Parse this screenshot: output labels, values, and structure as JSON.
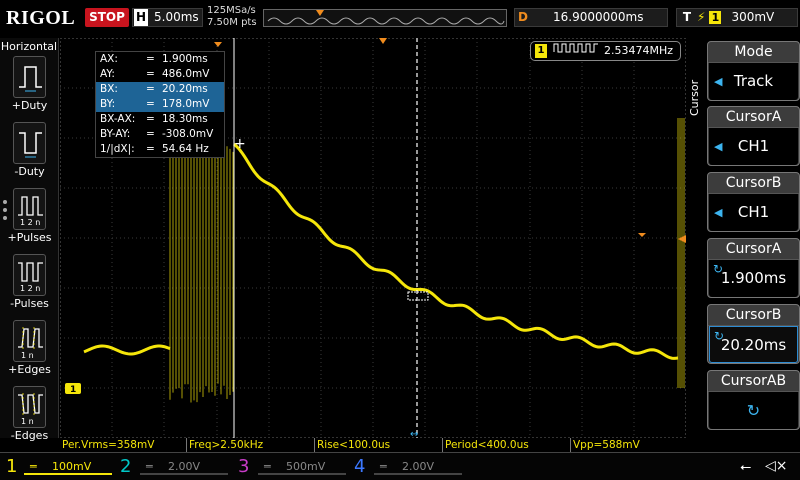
{
  "top": {
    "brand": "RIGOL",
    "run_state": "STOP",
    "horizontal_label": "H",
    "horizontal_scale": "5.00ms",
    "sample_rate": "125MSa/s",
    "memory_depth": "7.50M pts",
    "delay_label": "D",
    "delay_value": "16.9000000ms",
    "trigger_label": "T",
    "trigger_channel": "1",
    "trigger_level": "300mV"
  },
  "left_panel": {
    "title": "Horizontal",
    "items": [
      {
        "label": "+Duty"
      },
      {
        "label": "-Duty"
      },
      {
        "label": "+Pulses"
      },
      {
        "label": "-Pulses"
      },
      {
        "label": "+Edges"
      },
      {
        "label": "-Edges"
      }
    ]
  },
  "cursor_readout": {
    "rows": [
      {
        "key": "AX:",
        "value": "1.900ms",
        "highlight": false
      },
      {
        "key": "AY:",
        "value": "486.0mV",
        "highlight": false
      },
      {
        "key": "BX:",
        "value": "20.20ms",
        "highlight": true
      },
      {
        "key": "BY:",
        "value": "178.0mV",
        "highlight": true
      },
      {
        "key": "BX-AX:",
        "value": "18.30ms",
        "highlight": false
      },
      {
        "key": "BY-AY:",
        "value": "-308.0mV",
        "highlight": false
      },
      {
        "key": "1/|dX|:",
        "value": "54.64 Hz",
        "highlight": false
      }
    ]
  },
  "frequency_counter": {
    "channel": "1",
    "value": "2.53474MHz"
  },
  "measurements": [
    "Per.Vrms=358mV",
    "Freq>2.50kHz",
    "Rise<100.0us",
    "Period<400.0us",
    "Vpp=588mV"
  ],
  "channels": [
    {
      "number": "1",
      "scale": "100mV",
      "color": "#f5e60a",
      "active": true
    },
    {
      "number": "2",
      "scale": "2.00V",
      "color": "#00c8c8",
      "active": false
    },
    {
      "number": "3",
      "scale": "500mV",
      "color": "#c83cc8",
      "active": false
    },
    {
      "number": "4",
      "scale": "2.00V",
      "color": "#3c78ff",
      "active": false
    }
  ],
  "right_panel": {
    "section_label": "Cursor",
    "buttons": [
      {
        "title": "Mode",
        "value": "Track",
        "control": "arrow"
      },
      {
        "title": "CursorA",
        "value": "CH1",
        "control": "arrow"
      },
      {
        "title": "CursorB",
        "value": "CH1",
        "control": "arrow"
      },
      {
        "title": "CursorA",
        "value": "1.900ms",
        "control": "knob"
      },
      {
        "title": "CursorB",
        "value": "20.20ms",
        "control": "knob"
      },
      {
        "title": "CursorAB",
        "value": "",
        "control": "knob"
      }
    ]
  },
  "icons": {
    "usb": "usb-icon",
    "speaker": "speaker-muted-icon"
  },
  "colors": {
    "ch1": "#f5e60a",
    "trigger": "#f08c1e",
    "stop": "#c8141e",
    "highlight": "#2d8cd2"
  }
}
